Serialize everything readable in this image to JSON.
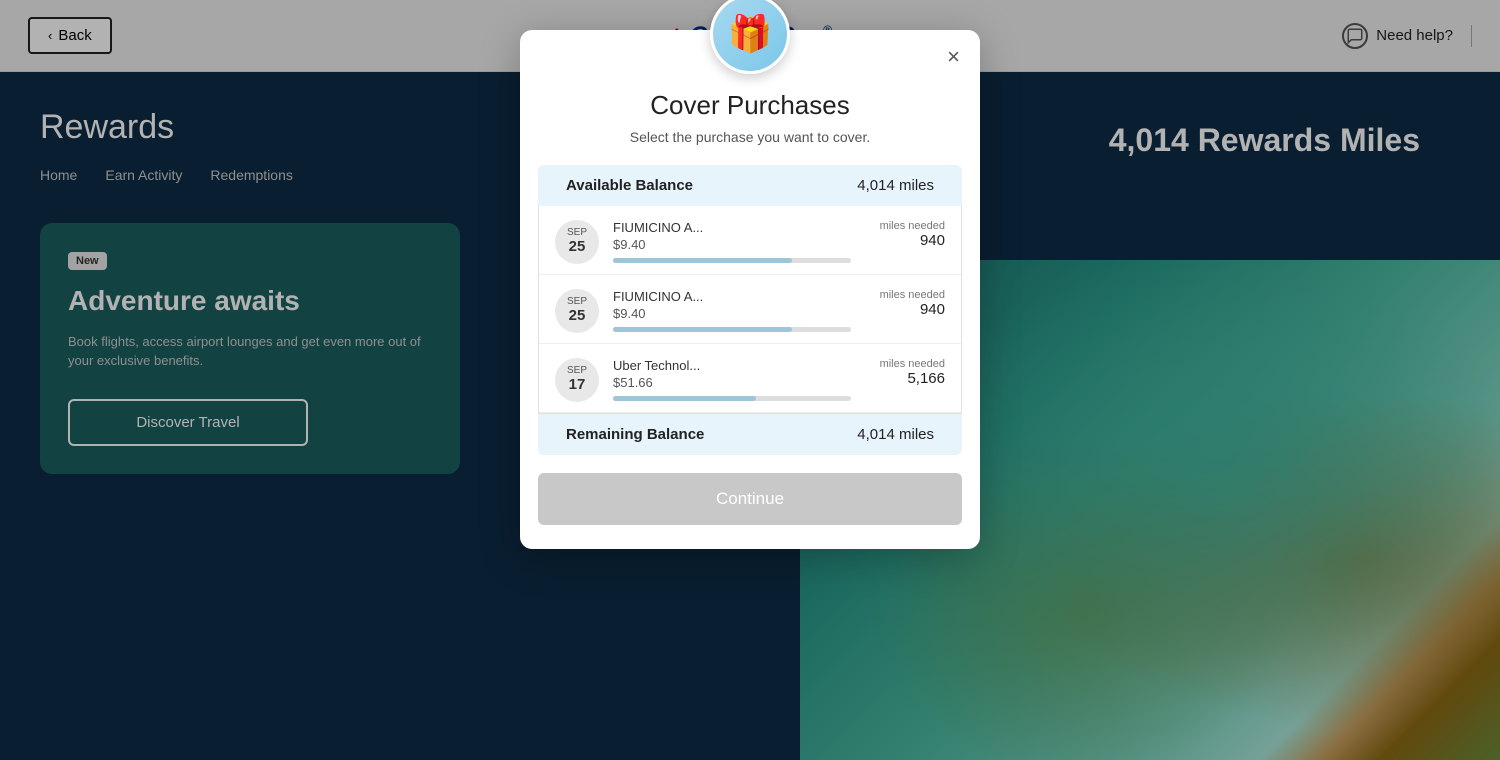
{
  "header": {
    "back_label": "Back",
    "logo_text": "Capital One",
    "logo_trademark": "®",
    "need_help_label": "Need help?"
  },
  "sidebar": {
    "title": "Rewards",
    "nav": [
      "Home",
      "Earn Activity",
      "Redemptions"
    ],
    "promo": {
      "badge": "New",
      "title": "Adventure awaits",
      "description": "Book flights, access airport lounges and get even more out of your exclusive benefits.",
      "cta": "Discover Travel"
    }
  },
  "miles_display": "4,014 Rewards Miles",
  "modal": {
    "title": "Cover Purchases",
    "subtitle": "Select the purchase you want to cover.",
    "close_label": "×",
    "available_balance_label": "Available Balance",
    "available_balance_value": "4,014 miles",
    "purchases": [
      {
        "month": "Sep",
        "day": "25",
        "name": "FIUMICINO A...",
        "amount": "$9.40",
        "miles_needed_label": "miles needed",
        "miles_needed": "940",
        "progress_pct": 75
      },
      {
        "month": "Sep",
        "day": "25",
        "name": "FIUMICINO A...",
        "amount": "$9.40",
        "miles_needed_label": "miles needed",
        "miles_needed": "940",
        "progress_pct": 75
      },
      {
        "month": "Sep",
        "day": "17",
        "name": "Uber Technol...",
        "amount": "$51.66",
        "miles_needed_label": "miles needed",
        "miles_needed": "5,166",
        "progress_pct": 60
      }
    ],
    "remaining_balance_label": "Remaining Balance",
    "remaining_balance_value": "4,014 miles",
    "continue_label": "Continue"
  }
}
